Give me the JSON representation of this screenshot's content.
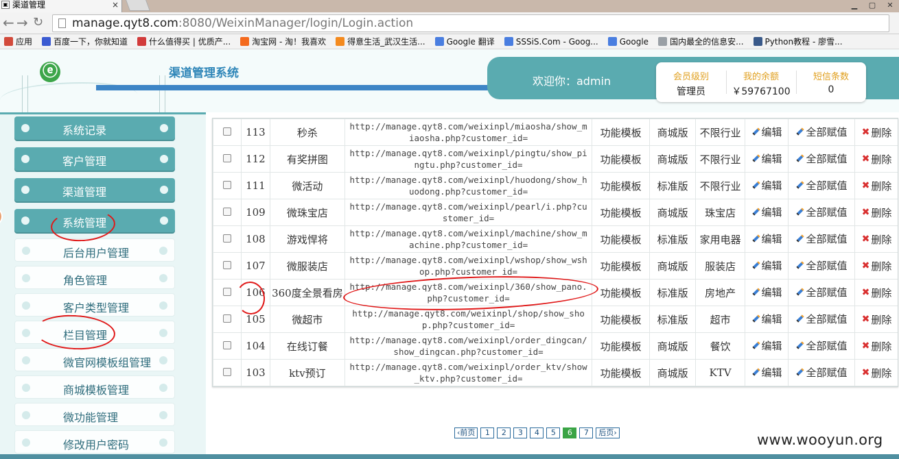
{
  "browser": {
    "tab_title": "渠道管理",
    "url_host": "manage.qyt8.com",
    "url_rest": ":8080/WeixinManager/login/Login.action",
    "bookmarks": [
      {
        "label": "应用",
        "icon": "apps-icon",
        "color": "#d24a3b"
      },
      {
        "label": "百度一下，你就知道",
        "icon": "baidu-icon",
        "color": "#3b5bd2"
      },
      {
        "label": "什么值得买 | 优质产...",
        "icon": "smzdm-icon",
        "color": "#d23b3b"
      },
      {
        "label": "淘宝网 - 淘！我喜欢",
        "icon": "taobao-icon",
        "color": "#f46a1e"
      },
      {
        "label": "得意生活_武汉生活...",
        "icon": "deyi-icon",
        "color": "#f48a1e"
      },
      {
        "label": "Google 翻译",
        "icon": "translate-icon",
        "color": "#4a7ee0"
      },
      {
        "label": "SSSiS.Com - Goog...",
        "icon": "google-icon",
        "color": "#4a7ee0"
      },
      {
        "label": "Google",
        "icon": "google-icon",
        "color": "#4a7ee0"
      },
      {
        "label": "国内最全的信息安...",
        "icon": "page-icon",
        "color": "#9aa0a6"
      },
      {
        "label": "Python教程 - 廖雪...",
        "icon": "python-icon",
        "color": "#3a5a8a"
      }
    ]
  },
  "header": {
    "system_title": "渠道管理系统",
    "welcome": "欢迎你：admin",
    "stats": [
      {
        "label": "会员级别",
        "value": "管理员"
      },
      {
        "label": "我的余额",
        "value": "￥59767100"
      },
      {
        "label": "短信条数",
        "value": "0"
      }
    ]
  },
  "sidebar": {
    "main_items": [
      {
        "label": "系统记录"
      },
      {
        "label": "客户管理"
      },
      {
        "label": "渠道管理"
      },
      {
        "label": "系统管理"
      }
    ],
    "sub_items": [
      {
        "label": "后台用户管理"
      },
      {
        "label": "角色管理"
      },
      {
        "label": "客户类型管理"
      },
      {
        "label": "栏目管理"
      },
      {
        "label": "微官网模板组管理"
      },
      {
        "label": "商城模板管理"
      },
      {
        "label": "微功能管理"
      },
      {
        "label": "修改用户密码"
      }
    ]
  },
  "table": {
    "actions": {
      "edit": "编辑",
      "assign_all": "全部赋值",
      "delete": "删除"
    },
    "rows": [
      {
        "id": "113",
        "name": "秒杀",
        "url": "http://manage.qyt8.com/weixinpl/miaosha/show_miaosha.php?customer_id=",
        "type": "功能模板",
        "edition": "商城版",
        "industry": "不限行业"
      },
      {
        "id": "112",
        "name": "有奖拼图",
        "url": "http://manage.qyt8.com/weixinpl/pingtu/show_pingtu.php?customer_id=",
        "type": "功能模板",
        "edition": "商城版",
        "industry": "不限行业"
      },
      {
        "id": "111",
        "name": "微活动",
        "url": "http://manage.qyt8.com/weixinpl/huodong/show_huodong.php?customer_id=",
        "type": "功能模板",
        "edition": "标准版",
        "industry": "不限行业"
      },
      {
        "id": "109",
        "name": "微珠宝店",
        "url": "http://manage.qyt8.com/weixinpl/pearl/i.php?customer_id=",
        "type": "功能模板",
        "edition": "商城版",
        "industry": "珠宝店"
      },
      {
        "id": "108",
        "name": "游戏悍将",
        "url": "http://manage.qyt8.com/weixinpl/machine/show_machine.php?customer_id=",
        "type": "功能模板",
        "edition": "标准版",
        "industry": "家用电器"
      },
      {
        "id": "107",
        "name": "微服装店",
        "url": "http://manage.qyt8.com/weixinpl/wshop/show_wshop.php?customer_id=",
        "type": "功能模板",
        "edition": "商城版",
        "industry": "服装店"
      },
      {
        "id": "106",
        "name": "360度全景看房",
        "url": "http://manage.qyt8.com/weixinpl/360/show_pano.php?customer_id=",
        "type": "功能模板",
        "edition": "标准版",
        "industry": "房地产"
      },
      {
        "id": "105",
        "name": "微超市",
        "url": "http://manage.qyt8.com/weixinpl/shop/show_shop.php?customer_id=",
        "type": "功能模板",
        "edition": "标准版",
        "industry": "超市"
      },
      {
        "id": "104",
        "name": "在线订餐",
        "url": "http://manage.qyt8.com/weixinpl/order_dingcan/show_dingcan.php?customer_id=",
        "type": "功能模板",
        "edition": "商城版",
        "industry": "餐饮"
      },
      {
        "id": "103",
        "name": "ktv预订",
        "url": "http://manage.qyt8.com/weixinpl/order_ktv/show_ktv.php?customer_id=",
        "type": "功能模板",
        "edition": "商城版",
        "industry": "KTV"
      }
    ]
  },
  "pagination": {
    "prev": "‹前页",
    "pages": [
      "1",
      "2",
      "3",
      "4",
      "5",
      "6",
      "7"
    ],
    "current": "6",
    "next": "后页›"
  },
  "watermark": "www.wooyun.org",
  "colors": {
    "accent": "#5aabb0",
    "title_blue": "#2f86b8",
    "annotation_red": "#e01818"
  }
}
